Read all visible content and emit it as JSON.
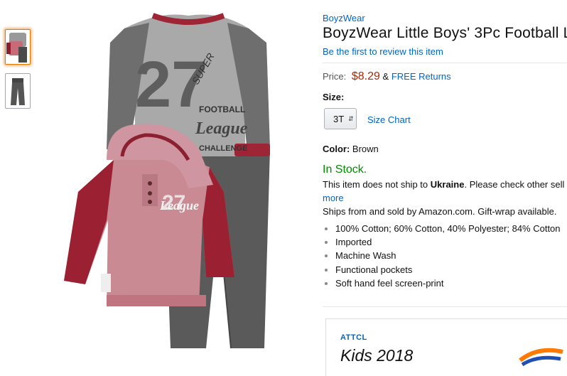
{
  "thumbnails": [
    {
      "icon": "outfit-set-thumbnail",
      "selected": true
    },
    {
      "icon": "jeans-thumbnail",
      "selected": false
    }
  ],
  "product": {
    "brand": "BoyzWear",
    "title": "BoyzWear Little Boys' 3Pc Football L",
    "review_link": "Be the first to review this item",
    "price_label": "Price:",
    "price": "$8.29",
    "price_sep": "&",
    "free_returns": "FREE Returns",
    "size_label": "Size:",
    "size_value": "3T",
    "size_chart": "Size Chart",
    "color_label": "Color:",
    "color_value": "Brown",
    "stock": "In Stock.",
    "ship_text": "This item does not ship to",
    "ship_country": "Ukraine",
    "ship_rest": ". Please check other sell",
    "more": "more",
    "sold_by": "Ships from and sold by Amazon.com. Gift-wrap available.",
    "bullets": [
      "100% Cotton; 60% Cotton, 40% Polyester; 84% Cotton",
      "Imported",
      "Machine Wash",
      "Functional pockets",
      "Soft hand feel screen-print"
    ]
  },
  "shirt_print": {
    "number": "27",
    "arc_top": "FOOTBALL",
    "script": "League",
    "arc_bottom": "CHALLENGE",
    "super": "SUPER"
  },
  "ad": {
    "brand": "ATTCL",
    "title": "Kids 2018"
  },
  "colors": {
    "link": "#0066c0",
    "price": "#b12704",
    "stock": "#008a00",
    "selected_border": "#e77600"
  }
}
